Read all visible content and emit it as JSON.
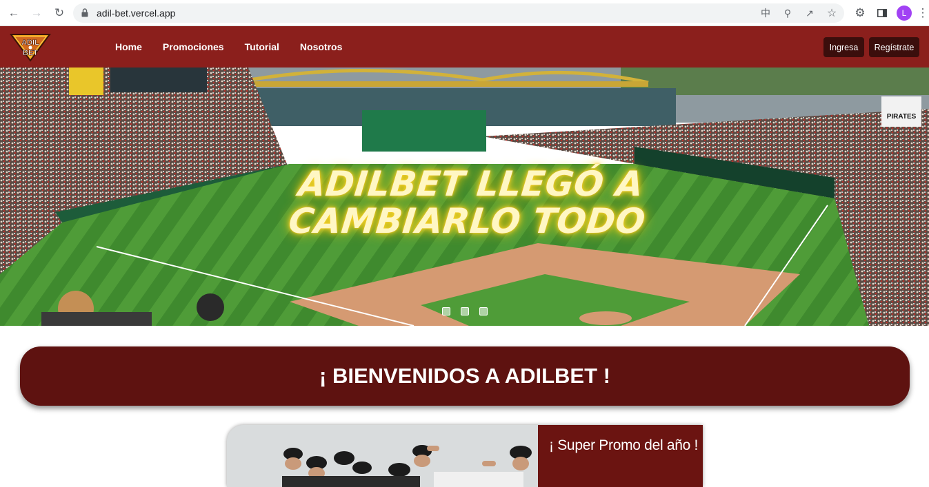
{
  "browser": {
    "url": "adil-bet.vercel.app",
    "profile_initial": "L"
  },
  "site": {
    "logo": {
      "line1": "ADIL",
      "line2": "BET"
    },
    "nav": [
      "Home",
      "Promociones",
      "Tutorial",
      "Nosotros"
    ],
    "login_label": "Ingresa",
    "register_label": "Regístrate"
  },
  "hero": {
    "title_line1": "ADILBET LLEGÓ A",
    "title_line2": "CAMBIARLO TODO",
    "carousel_slides": 3,
    "scoreboard_sign": "PIRATES"
  },
  "welcome": {
    "text": "¡ BIENVENIDOS A ADILBET !"
  },
  "promo": {
    "title": "¡ Super Promo del año !"
  },
  "colors": {
    "navbar": "#8b1f1c",
    "button_dark": "#3b0e0c",
    "welcome_bg": "#5e1210",
    "promo_bg": "#6b1411",
    "hero_title": "#fff7c4"
  }
}
